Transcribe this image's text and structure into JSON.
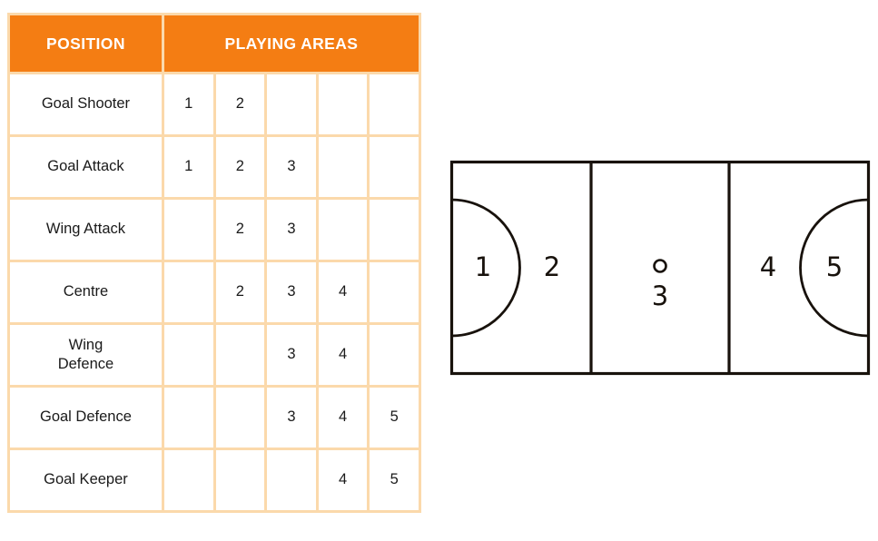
{
  "table": {
    "headers": {
      "position": "POSITION",
      "playing_areas": "PLAYING AREAS"
    },
    "area_columns": [
      "1",
      "2",
      "3",
      "4",
      "5"
    ],
    "rows": [
      {
        "position": "Goal Shooter",
        "areas": [
          "1",
          "2",
          "",
          "",
          ""
        ]
      },
      {
        "position": "Goal Attack",
        "areas": [
          "1",
          "2",
          "3",
          "",
          ""
        ]
      },
      {
        "position": "Wing Attack",
        "areas": [
          "",
          "2",
          "3",
          "",
          ""
        ]
      },
      {
        "position": "Centre",
        "areas": [
          "",
          "2",
          "3",
          "4",
          ""
        ]
      },
      {
        "position": "Wing\nDefence",
        "areas": [
          "",
          "",
          "3",
          "4",
          ""
        ]
      },
      {
        "position": "Goal Defence",
        "areas": [
          "",
          "",
          "3",
          "4",
          "5"
        ]
      },
      {
        "position": "Goal Keeper",
        "areas": [
          "",
          "",
          "",
          "4",
          "5"
        ]
      }
    ],
    "colors": {
      "header_background": "#f47d13",
      "header_text": "#ffffff",
      "grid_line": "#fbd9ab",
      "cell_background": "#ffffff",
      "cell_text": "#1a1a1a"
    }
  },
  "court": {
    "labels": {
      "area1": "1",
      "area2": "2",
      "area3": "3",
      "area4": "4",
      "area5": "5"
    },
    "colors": {
      "line": "#18120c",
      "fill": "#ffffff"
    }
  }
}
